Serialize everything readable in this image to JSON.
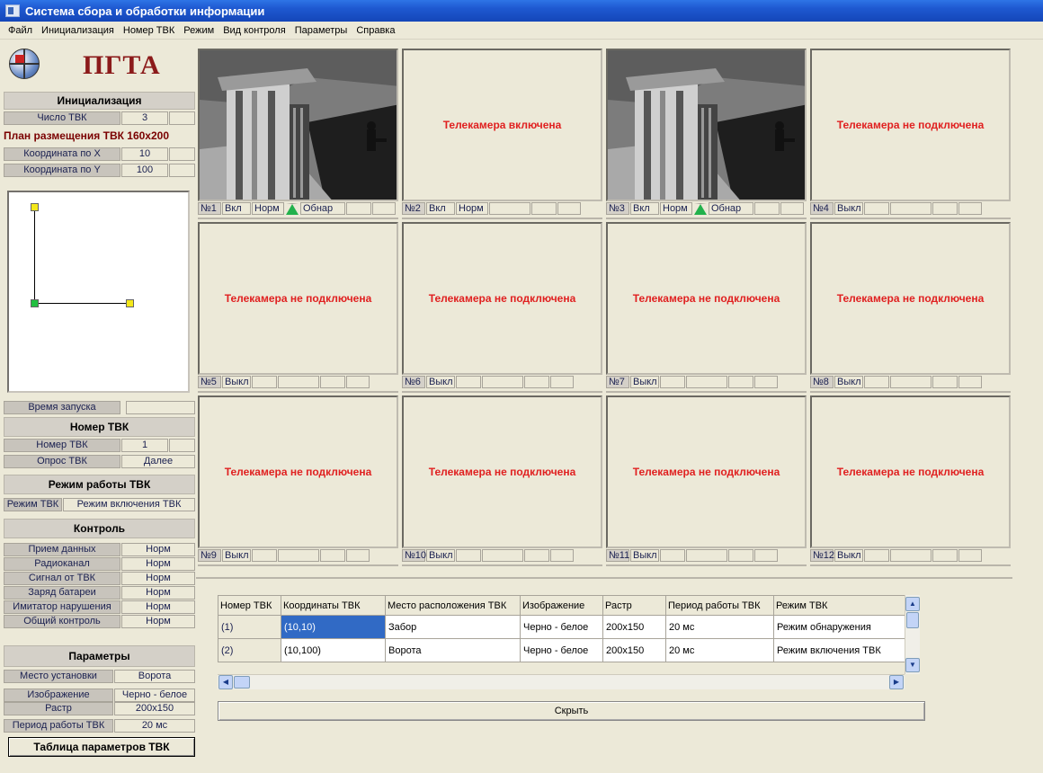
{
  "window": {
    "title": "Система сбора и обработки информации"
  },
  "menu": [
    "Файл",
    "Инициализация",
    "Номер ТВК",
    "Режим",
    "Вид контроля",
    "Параметры",
    "Справка"
  ],
  "logo": {
    "text": "ПГТА"
  },
  "left": {
    "init_title": "Инициализация",
    "tvk_count_label": "Число ТВК",
    "tvk_count_value": "3",
    "plan_title": "План размещения ТВК 160x200",
    "coord_x_label": "Координата по X",
    "coord_x_value": "10",
    "coord_y_label": "Координата по Y",
    "coord_y_value": "100",
    "start_time_label": "Время запуска",
    "tvk_num_title": "Номер ТВК",
    "tvk_num_label": "Номер ТВК",
    "tvk_num_value": "1",
    "poll_label": "Опрос ТВК",
    "poll_value": "Далее",
    "mode_title": "Режим работы ТВК",
    "mode_label": "Режим ТВК",
    "mode_value": "Режим включения ТВК",
    "control_title": "Контроль",
    "control_rows": [
      {
        "label": "Прием данных",
        "value": "Норм"
      },
      {
        "label": "Радиоканал",
        "value": "Норм"
      },
      {
        "label": "Сигнал от ТВК",
        "value": "Норм"
      },
      {
        "label": "Заряд батареи",
        "value": "Норм"
      },
      {
        "label": "Имитатор нарушения",
        "value": "Норм"
      },
      {
        "label": "Общий контроль",
        "value": "Норм"
      }
    ],
    "params_title": "Параметры",
    "param_rows": [
      {
        "label": "Место установки",
        "value": "Ворота"
      },
      {
        "label": "Изображение",
        "value": "Черно - белое"
      },
      {
        "label": "Растр",
        "value": "200x150"
      },
      {
        "label": "Период работы ТВК",
        "value": "20 мс"
      }
    ],
    "table_button": "Таблица параметров ТВК"
  },
  "cameras": [
    {
      "num": "№1",
      "state": "Вкл",
      "mode": "Норм",
      "detect": "Обнар",
      "msg": ""
    },
    {
      "num": "№2",
      "state": "Вкл",
      "mode": "Норм",
      "detect": "",
      "msg": "Телекамера включена"
    },
    {
      "num": "№3",
      "state": "Вкл",
      "mode": "Норм",
      "detect": "Обнар",
      "msg": ""
    },
    {
      "num": "№4",
      "state": "Выкл",
      "mode": "",
      "detect": "",
      "msg": "Телекамера не подключена"
    },
    {
      "num": "№5",
      "state": "Выкл",
      "mode": "",
      "detect": "",
      "msg": "Телекамера не подключена"
    },
    {
      "num": "№6",
      "state": "Выкл",
      "mode": "",
      "detect": "",
      "msg": "Телекамера не подключена"
    },
    {
      "num": "№7",
      "state": "Выкл",
      "mode": "",
      "detect": "",
      "msg": "Телекамера не подключена"
    },
    {
      "num": "№8",
      "state": "Выкл",
      "mode": "",
      "detect": "",
      "msg": "Телекамера не подключена"
    },
    {
      "num": "№9",
      "state": "Выкл",
      "mode": "",
      "detect": "",
      "msg": "Телекамера не подключена"
    },
    {
      "num": "№10",
      "state": "Выкл",
      "mode": "",
      "detect": "",
      "msg": "Телекамера не подключена"
    },
    {
      "num": "№11",
      "state": "Выкл",
      "mode": "",
      "detect": "",
      "msg": "Телекамера не подключена"
    },
    {
      "num": "№12",
      "state": "Выкл",
      "mode": "",
      "detect": "",
      "msg": "Телекамера не подключена"
    }
  ],
  "table": {
    "headers": [
      "Номер ТВК",
      "Координаты ТВК",
      "Место расположения ТВК",
      "Изображение",
      "Растр",
      "Период работы ТВК",
      "Режим ТВК"
    ],
    "rows": [
      [
        "(1)",
        "(10,10)",
        "Забор",
        "Черно - белое",
        "200x150",
        "20 мс",
        "Режим обнаружения"
      ],
      [
        "(2)",
        "(10,100)",
        "Ворота",
        "Черно - белое",
        "200x150",
        "20 мс",
        "Режим включения ТВК"
      ]
    ]
  },
  "hide_button": "Скрыть",
  "colors": {
    "titlebar": "#1e58d0",
    "message": "#e02020",
    "selected": "#316ac5",
    "logo": "#8b1a1a"
  }
}
